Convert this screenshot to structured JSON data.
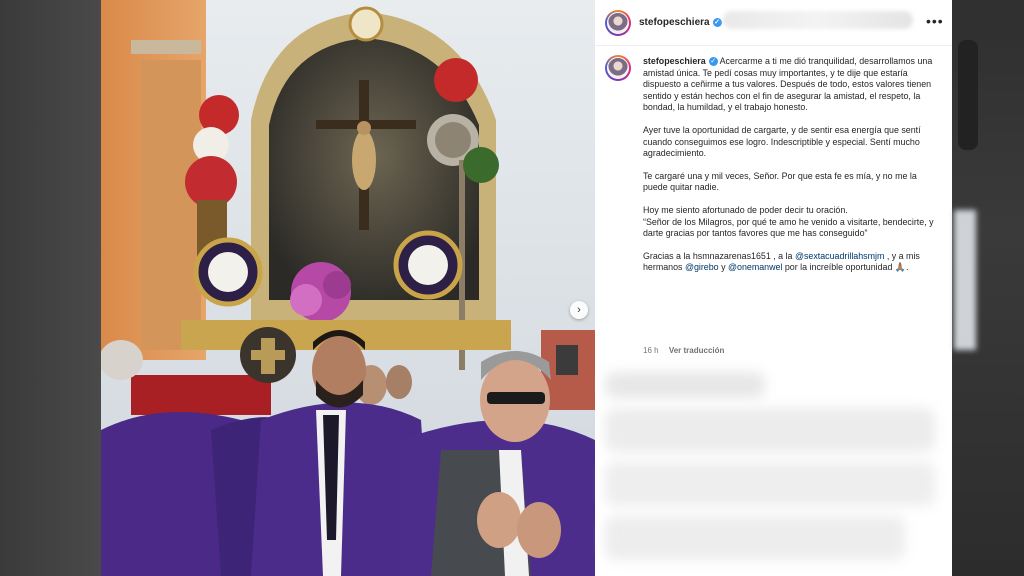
{
  "post": {
    "username": "stefopeschiera",
    "verified_badge": "✓",
    "more_icon": "•••",
    "next_icon": "›",
    "caption": {
      "p1": "Acercarme a ti me dió tranquilidad, desarrollamos una amistad única. Te pedí cosas muy importantes, y te dije que estaría dispuesto a ceñirme a tus valores. Después de todo, estos valores tienen sentido y están hechos con el fin de asegurar la amistad, el respeto, la bondad, la humildad, y el trabajo honesto.",
      "p2": "Ayer tuve la oportunidad de cargarte, y de sentir esa energía que sentí cuando conseguimos ese logro. Indescriptible y especial. Sentí mucho agradecimiento.",
      "p3": "Te cargaré una y mil veces, Señor. Por que esta fe es mía, y no me la puede quitar nadie.",
      "p4_line1": "Hoy me siento afortunado de poder decir tu oración.",
      "p4_line2": "“Señor de los Milagros, por qué te amo he venido a visitarte, bendecirte, y darte gracias por tantos favores que me has conseguido”",
      "p5_a": "Gracias a la hsmnazarenas1651 , a la ",
      "p5_link1": "@sextacuadrillahsmjm",
      "p5_b": " , y a mis hermanos ",
      "p5_link2": "@girebo",
      "p5_c": " y ",
      "p5_link3": "@onemanwel",
      "p5_d": " por la increíble oportunidad 🙏🏽."
    },
    "time_ago": "16 h",
    "translate_label": "Ver traducción"
  },
  "colors": {
    "purple_robe": "#4a2a86",
    "accent_link": "#00376b",
    "verified": "#3897f0"
  }
}
